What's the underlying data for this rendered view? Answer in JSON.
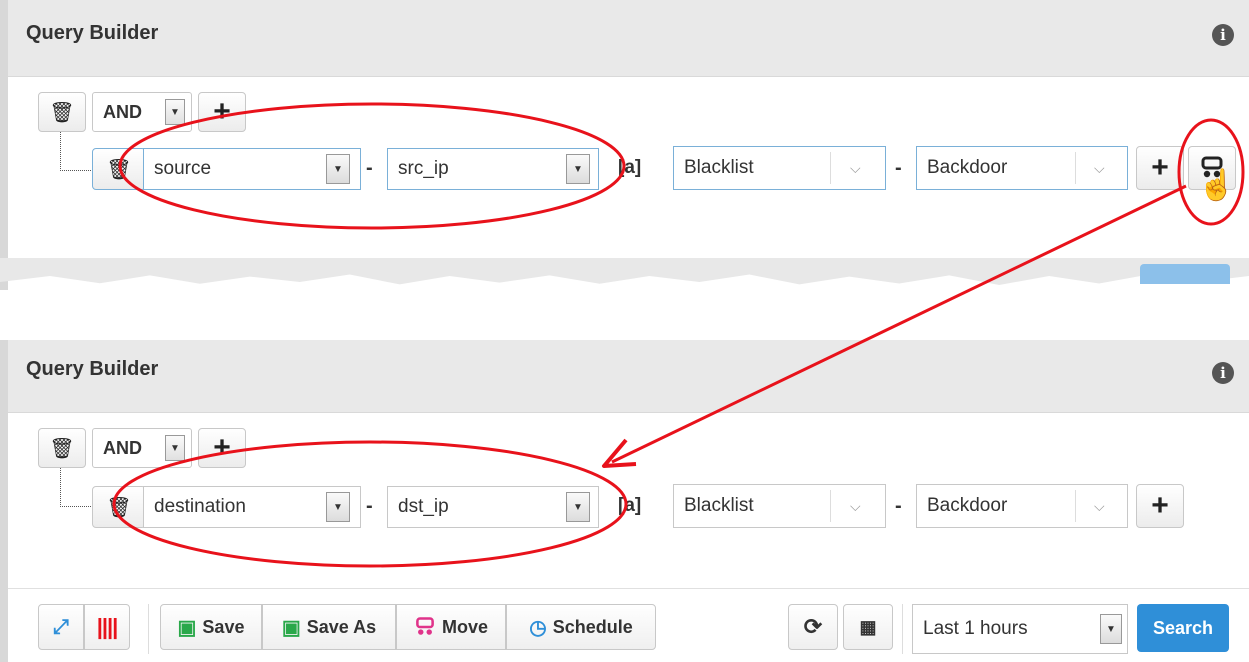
{
  "top_panel": {
    "title": "Query Builder",
    "info_icon": "i",
    "group_operator": "AND",
    "row": {
      "field": "source",
      "subfield": "src_ip",
      "operator": "[a]",
      "value1": "Blacklist",
      "value2": "Backdoor",
      "dash": "-"
    }
  },
  "bottom_panel": {
    "title": "Query Builder",
    "info_icon": "i",
    "group_operator": "AND",
    "row": {
      "field": "destination",
      "subfield": "dst_ip",
      "operator": "[a]",
      "value1": "Blacklist",
      "value2": "Backdoor",
      "dash": "-"
    },
    "toolbar": {
      "save": "Save",
      "save_as": "Save As",
      "move": "Move",
      "schedule": "Schedule",
      "time_range": "Last 1 hours",
      "search": "Search"
    }
  },
  "colors": {
    "highlight": "#e8121b",
    "accent": "#2f8fd8",
    "save_green": "#2aa84a",
    "move_pink": "#e0338a"
  }
}
